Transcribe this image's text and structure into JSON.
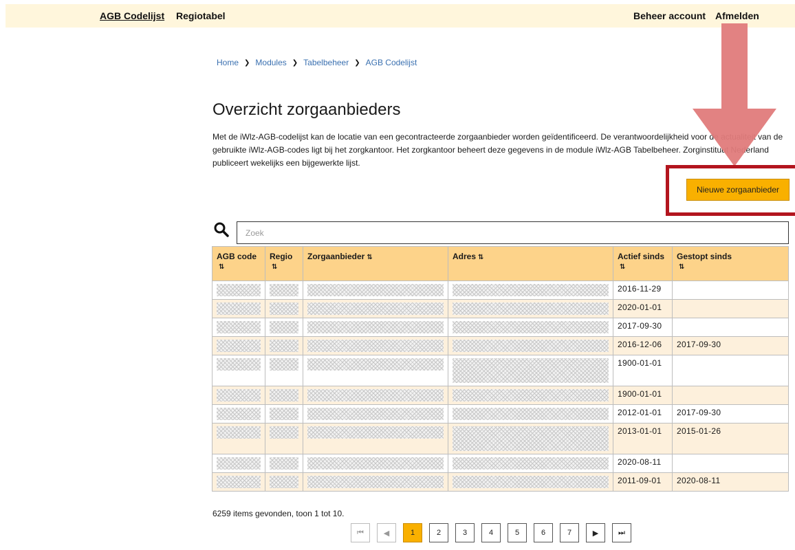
{
  "nav": {
    "agb_codelijst": "AGB Codelijst",
    "regiotabel": "Regiotabel",
    "beheer_account": "Beheer account",
    "afmelden": "Afmelden"
  },
  "breadcrumb": {
    "items": [
      "Home",
      "Modules",
      "Tabelbeheer",
      "AGB Codelijst"
    ]
  },
  "page": {
    "title": "Overzicht zorgaanbieders",
    "intro": "Met de iWlz-AGB-codelijst kan de locatie van een gecontracteerde zorgaanbieder worden geïdentificeerd. De verantwoordelijkheid voor de actualiteit van de gebruikte iWlz-AGB-codes ligt bij het zorgkantoor. Het zorgkantoor beheert deze gegevens in de module iWlz-AGB Tabelbeheer. Zorginstituut Nederland publiceert wekelijks een bijgewerkte lijst.",
    "new_button": "Nieuwe zorgaanbieder"
  },
  "search": {
    "placeholder": "Zoek",
    "value": ""
  },
  "table": {
    "columns": [
      "AGB code",
      "Regio",
      "Zorgaanbieder",
      "Adres",
      "Actief sinds",
      "Gestopt sinds"
    ],
    "sort_icon": "⇅",
    "rows": [
      {
        "actief": "2016-11-29",
        "gestopt": ""
      },
      {
        "actief": "2020-01-01",
        "gestopt": ""
      },
      {
        "actief": "2017-09-30",
        "gestopt": ""
      },
      {
        "actief": "2016-12-06",
        "gestopt": "2017-09-30"
      },
      {
        "actief": "1900-01-01",
        "gestopt": ""
      },
      {
        "actief": "1900-01-01",
        "gestopt": ""
      },
      {
        "actief": "2012-01-01",
        "gestopt": "2017-09-30"
      },
      {
        "actief": "2013-01-01",
        "gestopt": "2015-01-26"
      },
      {
        "actief": "2020-08-11",
        "gestopt": ""
      },
      {
        "actief": "2011-09-01",
        "gestopt": "2020-08-11"
      }
    ]
  },
  "pagination": {
    "summary": "6259 items gevonden, toon 1 tot 10.",
    "first": "⏮",
    "prev": "◀",
    "pages": [
      "1",
      "2",
      "3",
      "4",
      "5",
      "6",
      "7"
    ],
    "next": "▶",
    "last": "⏭",
    "current": "1"
  },
  "colors": {
    "accent": "#f9b000",
    "header_bg": "#fdd38a",
    "row_alt": "#fdf0dc",
    "topbar": "#fff6dc",
    "annotation_arrow": "#e07b7b",
    "annotation_box": "#b3151e"
  }
}
